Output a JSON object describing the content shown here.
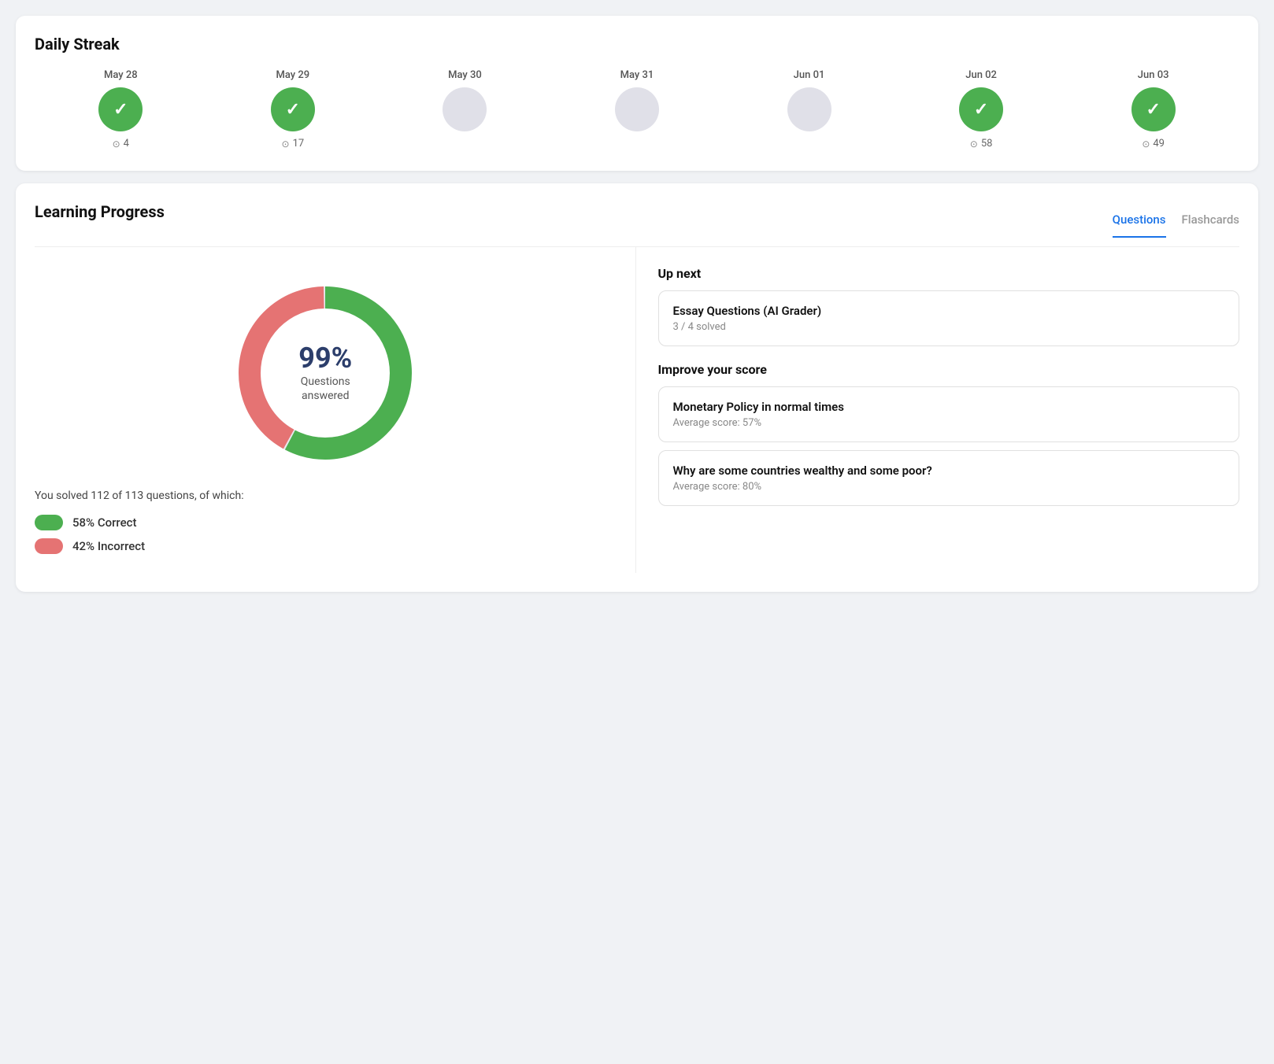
{
  "daily_streak": {
    "title": "Daily Streak",
    "days": [
      {
        "label": "May 28",
        "active": true,
        "score": "4",
        "has_score": true
      },
      {
        "label": "May 29",
        "active": true,
        "score": "17",
        "has_score": true
      },
      {
        "label": "May 30",
        "active": false,
        "score": "",
        "has_score": false
      },
      {
        "label": "May 31",
        "active": false,
        "score": "",
        "has_score": false
      },
      {
        "label": "Jun 01",
        "active": false,
        "score": "",
        "has_score": false
      },
      {
        "label": "Jun 02",
        "active": true,
        "score": "58",
        "has_score": true
      },
      {
        "label": "Jun 03",
        "active": true,
        "score": "49",
        "has_score": true
      }
    ]
  },
  "learning_progress": {
    "title": "Learning Progress",
    "tabs": [
      {
        "label": "Questions",
        "active": true
      },
      {
        "label": "Flashcards",
        "active": false
      }
    ],
    "chart": {
      "percent": "99%",
      "label": "Questions\nanswered",
      "correct_pct": 58,
      "incorrect_pct": 42,
      "gap_pct": 1
    },
    "stats_text": "You solved 112 of 113 questions, of which:",
    "legend": [
      {
        "type": "correct",
        "label": "58% Correct"
      },
      {
        "type": "incorrect",
        "label": "42% Incorrect"
      }
    ],
    "up_next": {
      "title": "Up next",
      "items": [
        {
          "title": "Essay Questions (AI Grader)",
          "sub": "3 / 4 solved"
        }
      ]
    },
    "improve": {
      "title": "Improve your score",
      "items": [
        {
          "title": "Monetary Policy in normal times",
          "sub": "Average score: 57%"
        },
        {
          "title": "Why are some countries wealthy and some poor?",
          "sub": "Average score: 80%"
        }
      ]
    }
  }
}
